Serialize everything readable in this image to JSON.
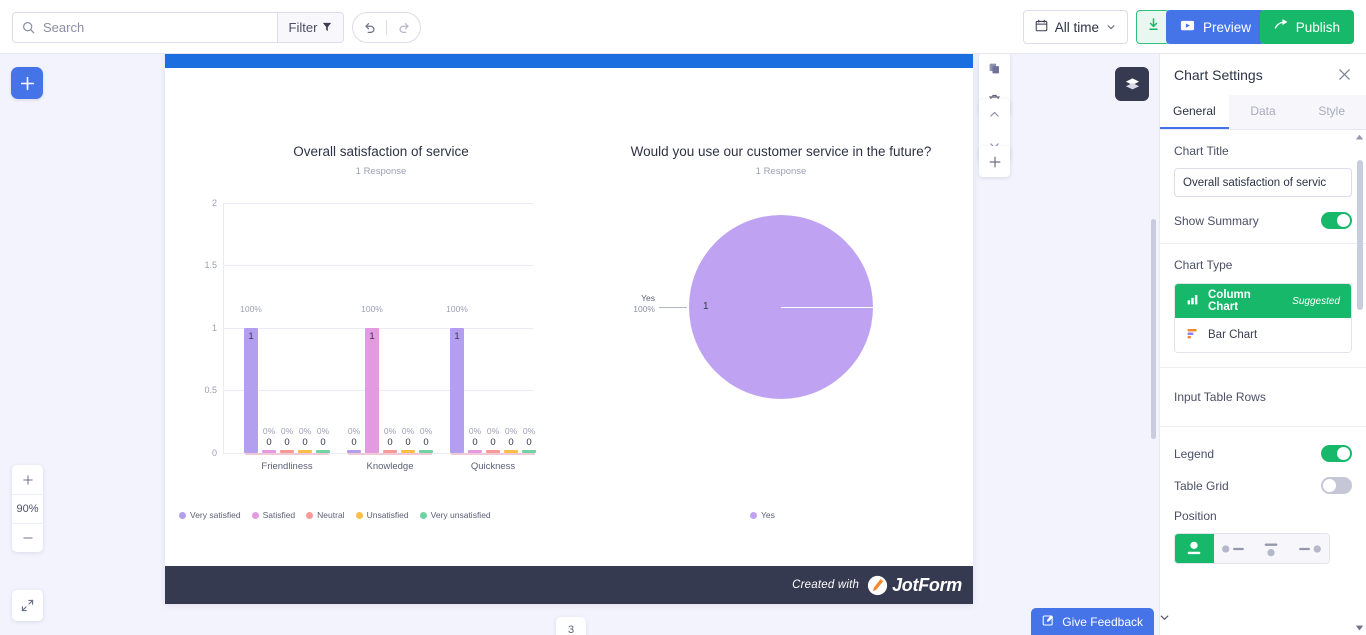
{
  "topbar": {
    "search_placeholder": "Search",
    "search_value": "",
    "filter_label": "Filter",
    "date_range_label": "All time",
    "preview_label": "Preview",
    "publish_label": "Publish"
  },
  "left_rail": {
    "zoom_in": "+",
    "zoom_level": "90%",
    "zoom_out": "−"
  },
  "canvas": {
    "page_number": "3",
    "footer_credit": "Created with",
    "footer_brand": "JotForm"
  },
  "charts": [
    {
      "title": "Overall satisfaction of service",
      "subtitle": "1 Response"
    },
    {
      "title": "Would you use our customer service in the future?",
      "subtitle": "1 Response"
    }
  ],
  "chart_data": [
    {
      "type": "bar",
      "title": "Overall satisfaction of service",
      "subtitle": "1 Response",
      "xlabel": "",
      "ylabel": "",
      "ylim": [
        0,
        2
      ],
      "yticks": [
        "0",
        "0.5",
        "1",
        "1.5",
        "2"
      ],
      "grid": true,
      "legend_position": "bottom",
      "categories": [
        "Friendliness",
        "Knowledge",
        "Quickness"
      ],
      "series": [
        {
          "name": "Very satisfied",
          "color": "#b49ef0",
          "values": [
            1,
            0,
            1
          ],
          "percents": [
            "100%",
            "0%",
            "100%"
          ]
        },
        {
          "name": "Satisfied",
          "color": "#e49ae0",
          "values": [
            0,
            1,
            0
          ],
          "percents": [
            "0%",
            "100%",
            "0%"
          ]
        },
        {
          "name": "Neutral",
          "color": "#f79a96",
          "values": [
            0,
            0,
            0
          ],
          "percents": [
            "0%",
            "0%",
            "0%"
          ]
        },
        {
          "name": "Unsatisfied",
          "color": "#f9be48",
          "values": [
            0,
            0,
            0
          ],
          "percents": [
            "0%",
            "0%",
            "0%"
          ]
        },
        {
          "name": "Very unsatisfied",
          "color": "#6fd3a2",
          "values": [
            0,
            0,
            0
          ],
          "percents": [
            "0%",
            "0%",
            "0%"
          ]
        }
      ]
    },
    {
      "type": "pie",
      "title": "Would you use our customer service in the future?",
      "subtitle": "1 Response",
      "legend_position": "bottom",
      "labels": [
        "Yes"
      ],
      "values": [
        1
      ],
      "percents": [
        "100%"
      ],
      "colors": [
        "#bfa3f2"
      ],
      "center_value": "1",
      "callout_label": "Yes",
      "callout_percent": "100%"
    }
  ],
  "panel": {
    "title": "Chart Settings",
    "tabs": [
      {
        "label": "General",
        "active": true
      },
      {
        "label": "Data",
        "active": false
      },
      {
        "label": "Style",
        "active": false
      }
    ],
    "chart_title_label": "Chart Title",
    "chart_title_value": "Overall satisfaction of servic",
    "show_summary_label": "Show Summary",
    "show_summary_on": true,
    "chart_type_label": "Chart Type",
    "chart_types": [
      {
        "label": "Column Chart",
        "badge": "Suggested",
        "selected": true
      },
      {
        "label": "Bar Chart",
        "badge": "",
        "selected": false
      }
    ],
    "input_table_rows_label": "Input Table Rows",
    "legend_label": "Legend",
    "legend_on": true,
    "table_grid_label": "Table Grid",
    "table_grid_on": false,
    "position_label": "Position"
  },
  "feedback": {
    "label": "Give Feedback"
  },
  "colors": {
    "accent_blue": "#4573e8",
    "accent_green": "#18b86a",
    "report_header": "#1b6ee0",
    "footer_dark": "#353a50"
  }
}
